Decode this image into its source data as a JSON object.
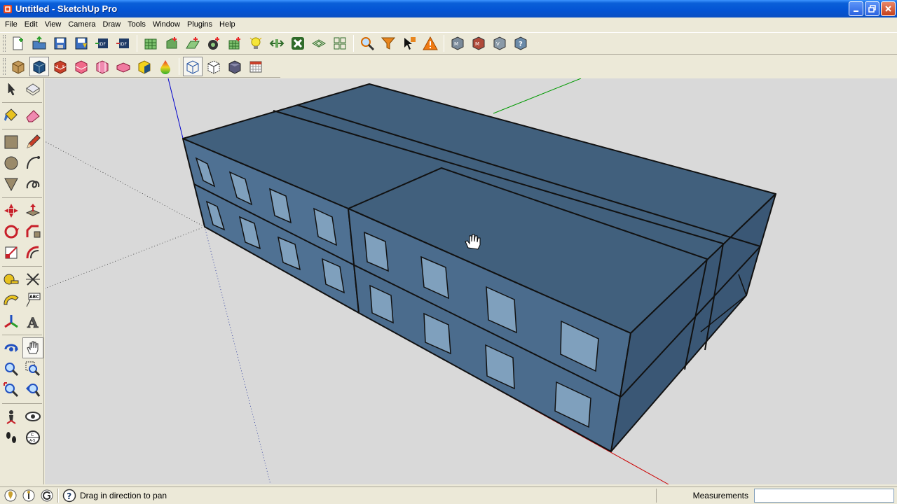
{
  "window": {
    "title": "Untitled - SketchUp Pro",
    "controls": [
      "minimize",
      "restore",
      "close"
    ]
  },
  "menu": [
    "File",
    "Edit",
    "View",
    "Camera",
    "Draw",
    "Tools",
    "Window",
    "Plugins",
    "Help"
  ],
  "toolbar_top": {
    "icons": [
      "new-file-icon",
      "open-file-icon",
      "save-icon",
      "save-template-icon",
      "idf-export-icon",
      "idf-import-icon",
      "zone-grid-icon",
      "add-zone-icon",
      "add-surface-icon",
      "add-space-icon",
      "add-subsurface-icon",
      "add-light-icon",
      "surface-match-icon",
      "construction-icon",
      "shading-icon",
      "layout-icon",
      "zoom-search-icon",
      "filter-icon",
      "select-info-icon",
      "warning-icon",
      "render-mode-1-icon",
      "render-mode-2-icon",
      "render-mode-3-icon",
      "help-icon"
    ],
    "idf_label": "IDF"
  },
  "toolbar_second": {
    "icons": [
      "box-icon",
      "box-blue-icon",
      "brick-icon",
      "brick-pink-icon",
      "block-pink-icon",
      "slab-pink-icon",
      "cube-yellow-icon",
      "droplet-icon",
      "wireframe-cube-icon",
      "xray-cube-icon",
      "solid-cube-icon",
      "calendar-icon"
    ]
  },
  "palette": {
    "tools": [
      "select-icon",
      "component-icon",
      "paint-bucket-icon",
      "eraser-icon",
      "rectangle-icon",
      "pencil-icon",
      "circle-icon",
      "arc-icon",
      "polygon-icon",
      "freehand-icon",
      "move-icon",
      "push-pull-icon",
      "rotate-icon",
      "follow-me-icon",
      "scale-icon",
      "offset-icon",
      "tape-measure-icon",
      "dimension-icon",
      "protractor-icon",
      "text-icon",
      "axes-icon",
      "3d-text-icon",
      "orbit-icon",
      "pan-icon",
      "zoom-icon",
      "zoom-window-icon",
      "zoom-extents-icon",
      "previous-view-icon",
      "position-camera-icon",
      "look-around-icon",
      "walk-icon",
      "section-plane-icon"
    ],
    "text_tool_label": "ABC",
    "section_label": "C\nA-5"
  },
  "status": {
    "hint": "Drag in direction to pan",
    "measurements_label": "Measurements",
    "measurements_value": ""
  },
  "colors": {
    "building_face": "#41607d",
    "building_face_front": "#4f7193",
    "window_glass": "#7fa0bd",
    "background": "#d9d9d9",
    "axis_red": "#cc0000",
    "axis_green": "#009900",
    "axis_blue": "#0000cc"
  }
}
